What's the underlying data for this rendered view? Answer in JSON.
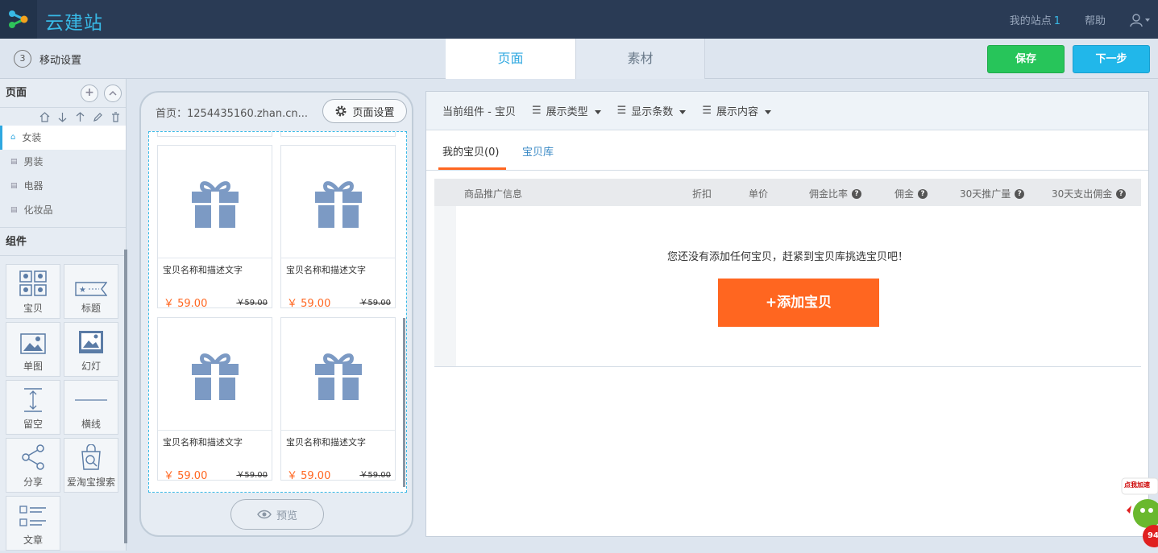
{
  "app": {
    "brand": "云建站",
    "my_sites_label": "我的站点",
    "my_sites_count": "1",
    "help": "帮助"
  },
  "step": {
    "number": "3",
    "title": "移动设置"
  },
  "tabs": {
    "page": "页面",
    "assets": "素材"
  },
  "actions": {
    "save": "保存",
    "next": "下一步"
  },
  "sidebar": {
    "pages_title": "页面",
    "pages": [
      "女装",
      "男装",
      "电器",
      "化妆品"
    ],
    "components_title": "组件",
    "components": [
      {
        "label": "宝贝",
        "icon": "grid-icon"
      },
      {
        "label": "标题",
        "icon": "title-icon"
      },
      {
        "label": "单图",
        "icon": "image-icon"
      },
      {
        "label": "幻灯",
        "icon": "slideshow-icon"
      },
      {
        "label": "留空",
        "icon": "spacer-icon"
      },
      {
        "label": "横线",
        "icon": "divider-icon"
      },
      {
        "label": "分享",
        "icon": "share-icon"
      },
      {
        "label": "爱淘宝搜索",
        "icon": "search-bag-icon"
      },
      {
        "label": "文章",
        "icon": "article-icon"
      }
    ]
  },
  "phone": {
    "header": "首页：1254435160.zhan.cn...",
    "page_settings": "页面设置",
    "products": [
      {
        "name": "宝贝名称和描述文字",
        "price": "￥ 59.00",
        "old_price": "￥59.00"
      },
      {
        "name": "宝贝名称和描述文字",
        "price": "￥ 59.00",
        "old_price": "￥59.00"
      },
      {
        "name": "宝贝名称和描述文字",
        "price": "￥ 59.00",
        "old_price": "￥59.00"
      },
      {
        "name": "宝贝名称和描述文字",
        "price": "￥ 59.00",
        "old_price": "￥59.00"
      }
    ],
    "preview": "预览"
  },
  "right": {
    "current_component": "当前组件 - 宝贝",
    "menus": [
      "展示类型",
      "显示条数",
      "展示内容"
    ],
    "sub_tabs": [
      "我的宝贝(0)",
      "宝贝库"
    ],
    "columns": [
      "商品推广信息",
      "折扣",
      "单价",
      "佣金比率",
      "佣金",
      "30天推广量",
      "30天支出佣金"
    ],
    "empty_message": "您还没有添加任何宝贝，赶紧到宝贝库挑选宝贝吧！",
    "add_button": "+添加宝贝"
  },
  "mascot": {
    "label": "点我加速",
    "value": "94"
  },
  "colors": {
    "accent": "#2fa8e0",
    "save": "#27c55a",
    "next": "#21b7ea",
    "orange": "#ff6620",
    "topbar": "#2a3b55"
  }
}
